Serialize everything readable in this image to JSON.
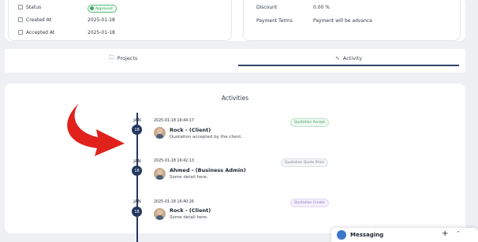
{
  "details_left": {
    "status_label": "Status",
    "status_value": "Approved",
    "created_label": "Created At",
    "created_value": "2025-01-18",
    "accepted_label": "Accepted At",
    "accepted_value": "2025-01-18"
  },
  "details_right": {
    "discount_label": "Discount",
    "discount_value": "0.00 %",
    "payment_label": "Payment Terms",
    "payment_value": "Payment will be advance"
  },
  "tabs": [
    {
      "label": "Projects",
      "icon": "folder-icon"
    },
    {
      "label": "Activity",
      "icon": "activity-icon",
      "active": true
    }
  ],
  "activities": {
    "title": "Activities",
    "items": [
      {
        "month": "JAN",
        "day": "18",
        "time": "2025-01-18 16:44:17",
        "user": "Rock - (Client)",
        "description": "Quotation accepted by the client.",
        "tag": "Quotation Accept"
      },
      {
        "month": "JAN",
        "day": "18",
        "time": "2025-01-18 16:42:13",
        "user": "Ahmed - (Business Admin)",
        "description": "Some detail here.",
        "tag": "Quotation Quote Price"
      },
      {
        "month": "JAN",
        "day": "18",
        "time": "2025-01-18 16:40:26",
        "user": "Rock - (Client)",
        "description": "Some detail here.",
        "tag": "Quotation Create"
      }
    ]
  },
  "messaging": {
    "label": "Messaging"
  },
  "colors": {
    "timeline": "#23385f",
    "accent_green": "#3aa75c",
    "arrow_red": "#e0211c"
  }
}
